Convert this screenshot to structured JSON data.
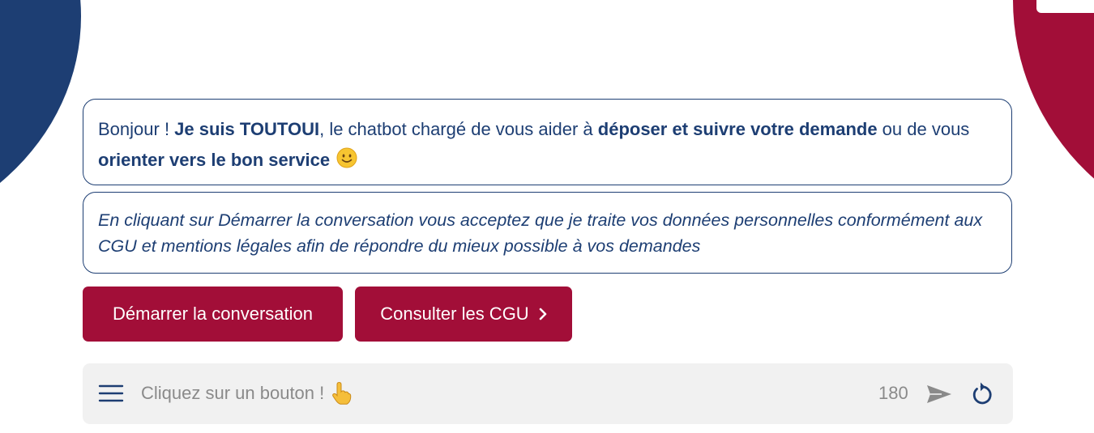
{
  "colors": {
    "navy": "#1d3e73",
    "crimson": "#a20e38",
    "input_background": "#f1f1f1",
    "placeholder": "#8a8a8a"
  },
  "intro_message": {
    "part1": "Bonjour ! ",
    "bold1": "Je suis TOUTOUI",
    "part2": ", le chatbot chargé de vous aider à ",
    "bold2": "déposer et suivre votre demande",
    "part3": " ou de vous ",
    "bold3": "orienter vers le bon service",
    "emoji_icon": "slightly-smiling-face-icon"
  },
  "consent_message": {
    "text": "En cliquant sur Démarrer la conversation vous acceptez que je traite vos données personnelles conformément aux CGU et mentions légales afin de répondre du mieux possible à vos demandes"
  },
  "buttons": {
    "start_label": "Démarrer la conversation",
    "cgu_label": "Consulter les CGU",
    "cgu_icon": "chevron-right-icon"
  },
  "input": {
    "placeholder": "Cliquez sur un bouton !",
    "placeholder_icon": "pointing-up-hand-icon",
    "char_counter": "180",
    "menu_icon": "hamburger-menu-icon",
    "send_icon": "send-icon",
    "reset_icon": "restart-icon"
  }
}
